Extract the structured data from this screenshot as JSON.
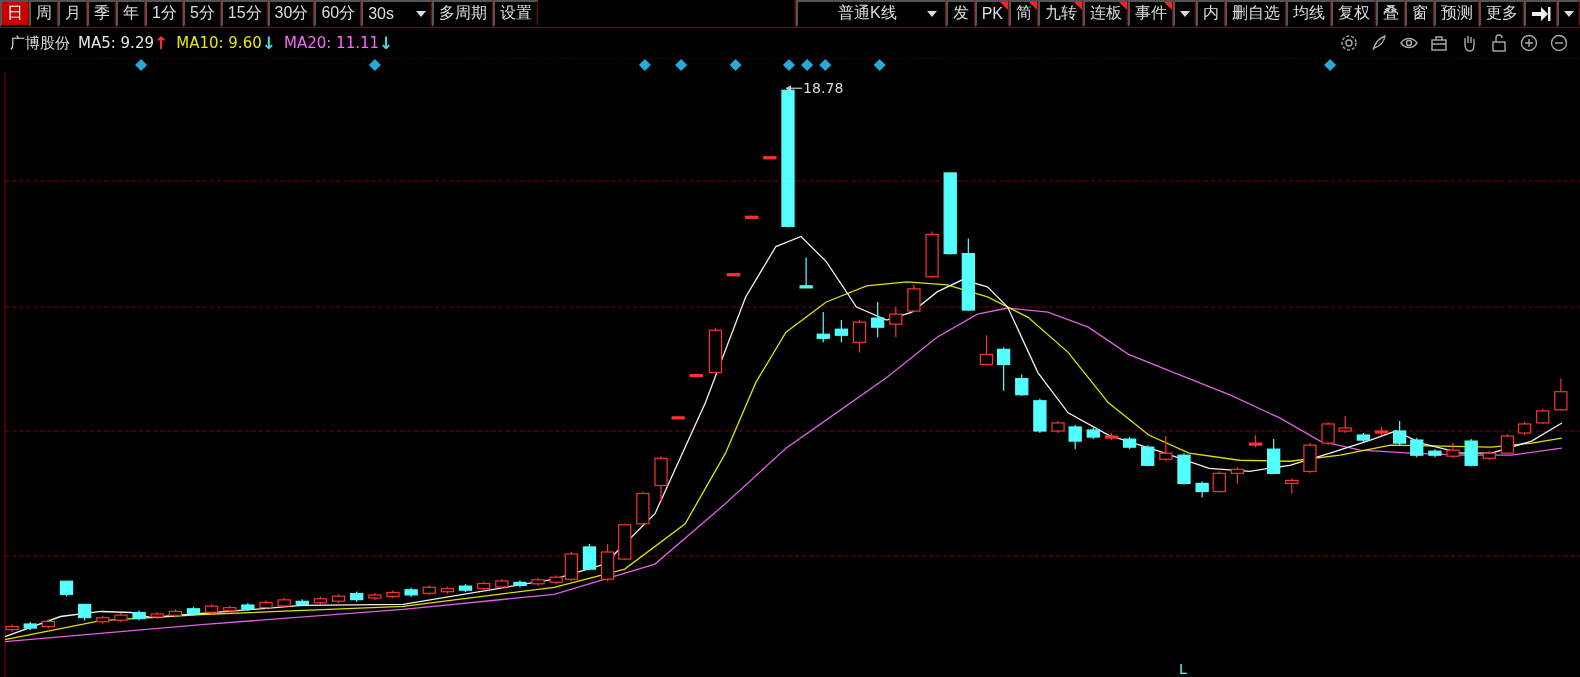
{
  "toolbar": {
    "periods": [
      {
        "label": "日",
        "selected": true
      },
      {
        "label": "周",
        "selected": false
      },
      {
        "label": "月",
        "selected": false
      },
      {
        "label": "季",
        "selected": false
      },
      {
        "label": "年",
        "selected": false
      },
      {
        "label": "1分",
        "selected": false
      },
      {
        "label": "5分",
        "selected": false
      },
      {
        "label": "15分",
        "selected": false
      },
      {
        "label": "30分",
        "selected": false
      },
      {
        "label": "60分",
        "selected": false
      }
    ],
    "interval_dropdown": {
      "value": "30s"
    },
    "left_buttons": [
      "多周期",
      "设置"
    ],
    "right_items": [
      {
        "kind": "dropdown",
        "label": "普通K线",
        "flag": false
      },
      {
        "kind": "button",
        "label": "发",
        "flag": false
      },
      {
        "kind": "button",
        "label": "PK",
        "flag": true
      },
      {
        "kind": "button",
        "label": "简",
        "flag": true
      },
      {
        "kind": "button",
        "label": "九转",
        "flag": true
      },
      {
        "kind": "button",
        "label": "连板",
        "flag": true
      },
      {
        "kind": "button",
        "label": "事件",
        "flag": true
      },
      {
        "kind": "caret"
      },
      {
        "kind": "button",
        "label": "内",
        "flag": false
      },
      {
        "kind": "button",
        "label": "删自选",
        "flag": false
      },
      {
        "kind": "button",
        "label": "均线",
        "flag": false
      },
      {
        "kind": "button",
        "label": "复权",
        "flag": false
      },
      {
        "kind": "button",
        "label": "叠",
        "flag": false
      },
      {
        "kind": "button",
        "label": "窗",
        "flag": false
      },
      {
        "kind": "button",
        "label": "预测",
        "flag": false
      },
      {
        "kind": "button",
        "label": "更多",
        "flag": false
      },
      {
        "kind": "icon"
      },
      {
        "kind": "caret"
      }
    ]
  },
  "legend": {
    "stock": "广博股份",
    "indicators": [
      {
        "label": "MA5: 9.29",
        "color": "#e6e6e6",
        "trend": {
          "arrow": "↑",
          "color": "#ff3030"
        }
      },
      {
        "label": "MA10: 9.60",
        "color": "#e8e800",
        "trend": {
          "arrow": "↓",
          "color": "#40e0e0"
        }
      },
      {
        "label": "MA20: 11.11",
        "color": "#ff66ff",
        "trend": {
          "arrow": "↓",
          "color": "#40e0e0"
        }
      }
    ]
  },
  "chart": {
    "peak_label": "18.78",
    "marker_text": "L"
  }
}
